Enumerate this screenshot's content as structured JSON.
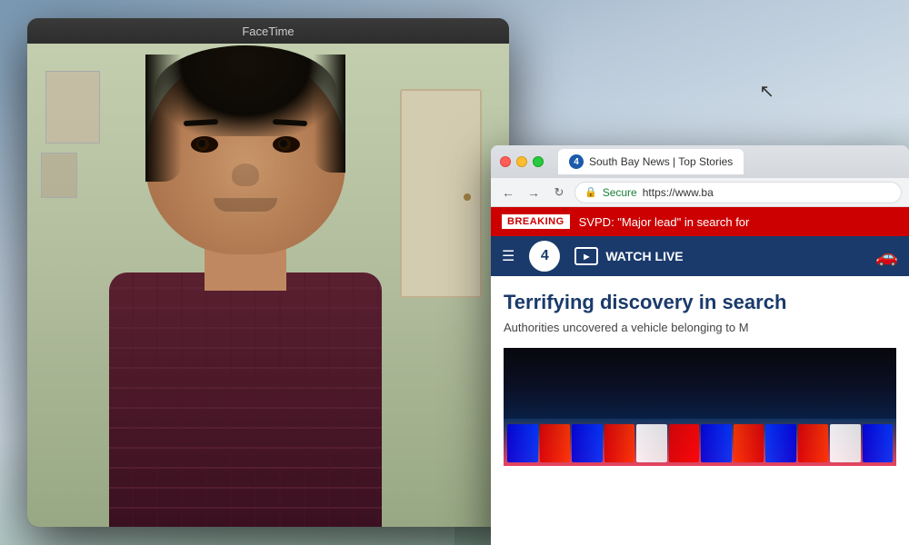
{
  "app": {
    "title": "FaceTime"
  },
  "desktop": {
    "cursor": "▶"
  },
  "browser": {
    "tab_title": "South Bay News | Top Stories",
    "tab_number": "4",
    "address_secure": "Secure",
    "address_url": "https://www.ba",
    "breaking_label": "BREAKING",
    "breaking_text": "SVPD: \"Major lead\" in search for",
    "nav_watch_live": "WATCH LIVE",
    "article_headline": "Terrifying discovery in search",
    "article_sub": "Authorities uncovered a vehicle belonging to M"
  },
  "facetime": {
    "title": "FaceTime"
  }
}
